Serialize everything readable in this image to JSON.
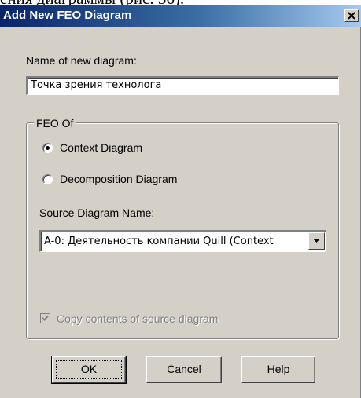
{
  "background_caption": "ения диаграммы (рис. 36).",
  "window": {
    "title": "Add New FEO Diagram",
    "close_icon": "close-icon"
  },
  "form": {
    "name_label": "Name of new diagram:",
    "name_value": "Точка зрения технолога",
    "group_title": "FEO Of",
    "radio_options": [
      {
        "label": "Context Diagram",
        "checked": true
      },
      {
        "label": "Decomposition Diagram",
        "checked": false
      }
    ],
    "source_label": "Source Diagram Name:",
    "source_value": "A-0:  Деятельность компании Quill (Context",
    "copy_label": "Copy contents of source diagram",
    "copy_checked": true,
    "copy_disabled": true
  },
  "buttons": {
    "ok": "OK",
    "cancel": "Cancel",
    "help": "Help"
  },
  "colors": {
    "title_start": "#0a246a",
    "title_end": "#a6caf0",
    "face": "#d4d0c8"
  }
}
